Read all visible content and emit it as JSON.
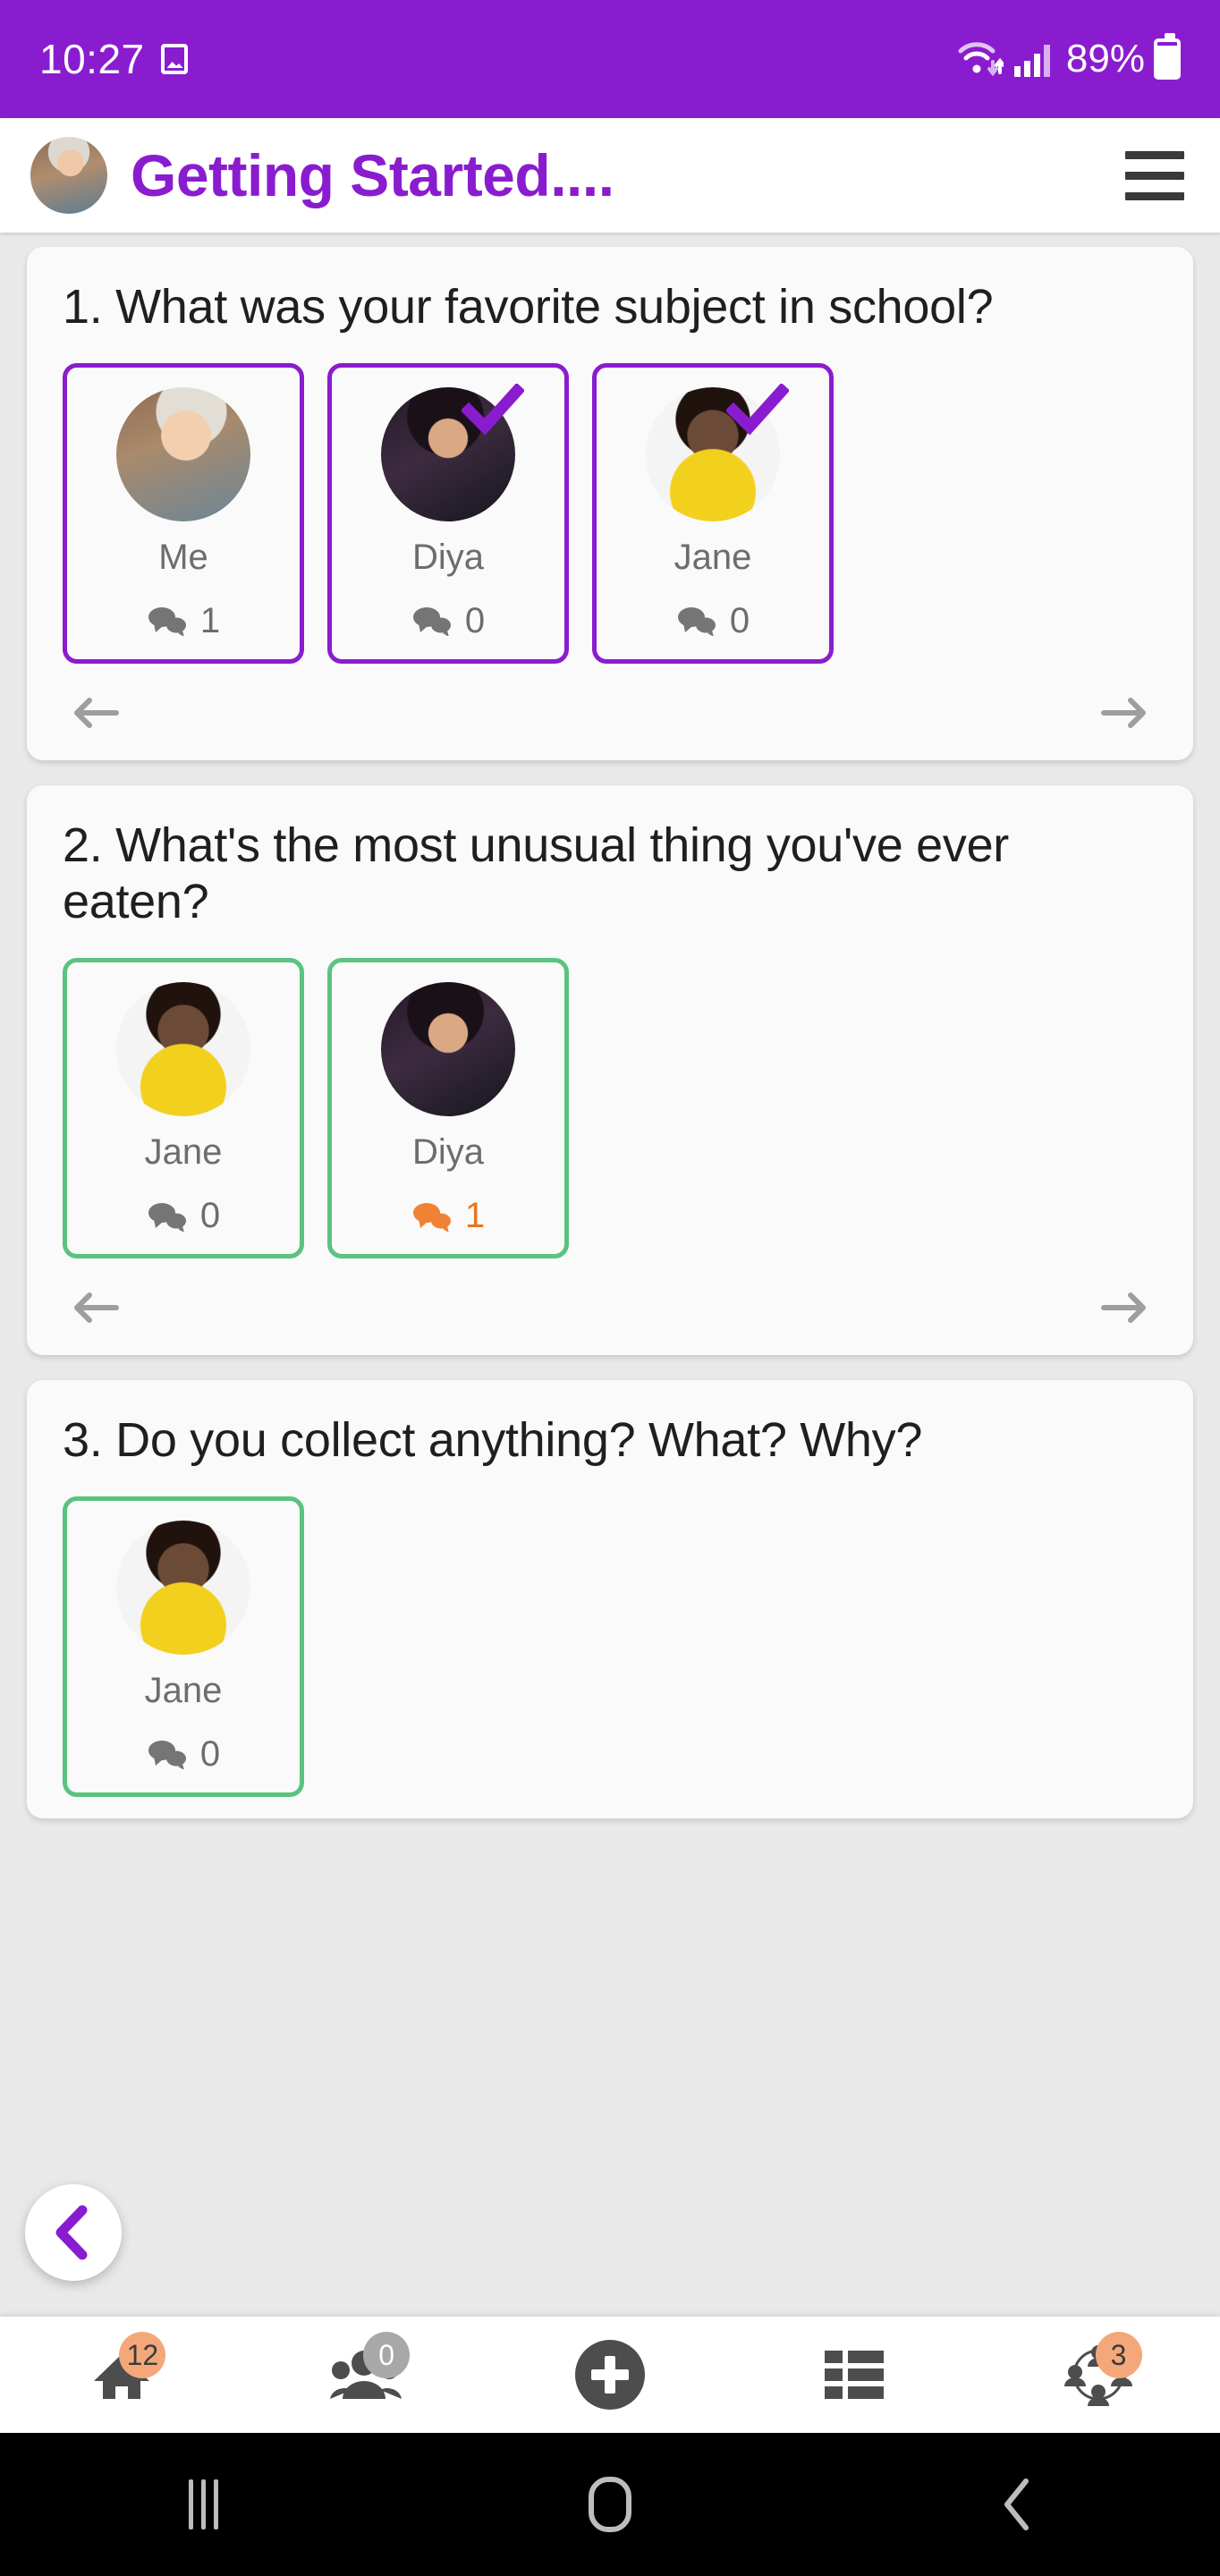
{
  "status_bar": {
    "time": "10:27",
    "battery_percent": "89%",
    "icons": [
      "image-icon",
      "wifi-icon",
      "cellular-signal-icon",
      "battery-icon"
    ],
    "background_color": "#8a1ccf"
  },
  "header": {
    "title": "Getting Started....",
    "title_color": "#8a1ccf",
    "avatar": "user-avatar",
    "menu": "hamburger-menu"
  },
  "theme": {
    "purple": "#8a1ccf",
    "green": "#5ac37f",
    "orange": "#e8761f",
    "badge_orange": "#f4a87a",
    "page_bg": "#e9e9e9",
    "card_bg": "#fafafa"
  },
  "questions": [
    {
      "text": "1. What was your favorite subject in school?",
      "border_color": "#8a1ccf",
      "answers": [
        {
          "name": "Me",
          "comments": "1",
          "checked": false,
          "comment_highlight": false,
          "avatar": "av-me"
        },
        {
          "name": "Diya",
          "comments": "0",
          "checked": true,
          "comment_highlight": false,
          "avatar": "av-diya"
        },
        {
          "name": "Jane",
          "comments": "0",
          "checked": true,
          "comment_highlight": false,
          "avatar": "av-jane"
        }
      ],
      "prev_label": "previous",
      "next_label": "next"
    },
    {
      "text": "2. What's the most unusual thing you've ever eaten?",
      "border_color": "#5ac37f",
      "answers": [
        {
          "name": "Jane",
          "comments": "0",
          "checked": false,
          "comment_highlight": false,
          "avatar": "av-jane"
        },
        {
          "name": "Diya",
          "comments": "1",
          "checked": false,
          "comment_highlight": true,
          "avatar": "av-diya"
        }
      ],
      "prev_label": "previous",
      "next_label": "next"
    },
    {
      "text": "3. Do you collect anything? What? Why?",
      "border_color": "#5ac37f",
      "answers": [
        {
          "name": "Jane",
          "comments": "0",
          "checked": false,
          "comment_highlight": false,
          "avatar": "av-jane"
        }
      ],
      "prev_label": "previous",
      "next_label": "next"
    }
  ],
  "fab": {
    "name": "back-button",
    "icon": "chevron-left-icon"
  },
  "bottom_nav": [
    {
      "icon": "home-icon",
      "badge": "12",
      "badge_style": "orange"
    },
    {
      "icon": "people-icon",
      "badge": "0",
      "badge_style": "gray"
    },
    {
      "icon": "plus-icon",
      "badge": "",
      "badge_style": "none"
    },
    {
      "icon": "list-grid-icon",
      "badge": "",
      "badge_style": "none"
    },
    {
      "icon": "group-network-icon",
      "badge": "3",
      "badge_style": "orange"
    }
  ],
  "android_nav": [
    {
      "icon": "recents-icon"
    },
    {
      "icon": "home-icon"
    },
    {
      "icon": "back-icon"
    }
  ]
}
